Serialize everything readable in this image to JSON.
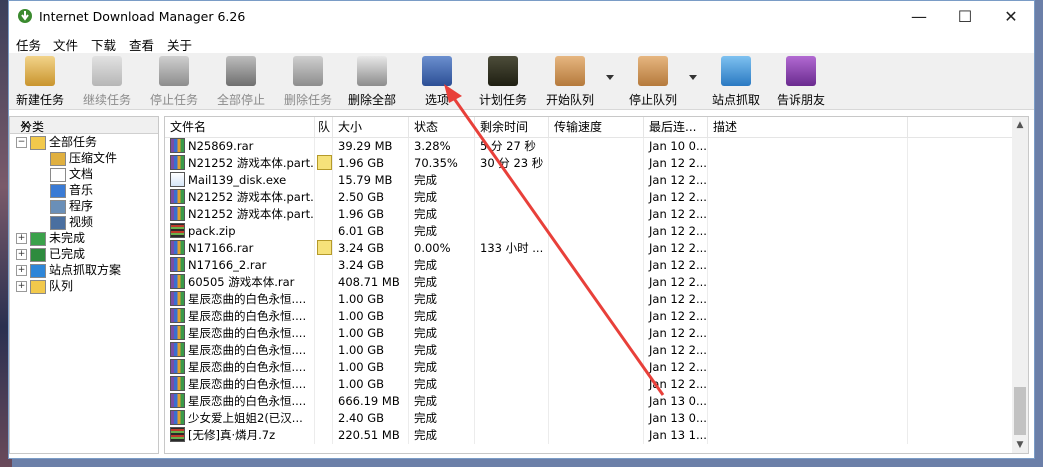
{
  "window": {
    "title": "Internet Download Manager 6.26"
  },
  "menu": [
    "任务",
    "文件",
    "下载",
    "查看",
    "关于"
  ],
  "toolbar": [
    {
      "label": "新建任务",
      "icon": "new-task-icon",
      "disabled": false
    },
    {
      "label": "继续任务",
      "icon": "resume-icon",
      "disabled": true
    },
    {
      "label": "停止任务",
      "icon": "stop-icon",
      "disabled": true
    },
    {
      "label": "全部停止",
      "icon": "stop-all-icon",
      "disabled": true
    },
    {
      "label": "删除任务",
      "icon": "delete-icon",
      "disabled": true
    },
    {
      "label": "删除全部",
      "icon": "delete-all-icon",
      "disabled": false
    },
    {
      "label": "选项",
      "icon": "options-icon",
      "disabled": false
    },
    {
      "label": "计划任务",
      "icon": "scheduler-icon",
      "disabled": false
    },
    {
      "label": "开始队列",
      "icon": "start-queue-icon",
      "disabled": false
    },
    {
      "label": "停止队列",
      "icon": "stop-queue-icon",
      "disabled": false
    },
    {
      "label": "站点抓取",
      "icon": "site-grabber-icon",
      "disabled": false
    },
    {
      "label": "告诉朋友",
      "icon": "tell-friend-icon",
      "disabled": false
    }
  ],
  "categories": {
    "header": "分类",
    "close": "×",
    "items": [
      {
        "label": "全部任务",
        "icon": "folder-open-icon",
        "level": 0,
        "expander": "−"
      },
      {
        "label": "压缩文件",
        "icon": "archive-icon",
        "level": 1,
        "expander": ""
      },
      {
        "label": "文档",
        "icon": "document-icon",
        "level": 1,
        "expander": ""
      },
      {
        "label": "音乐",
        "icon": "music-icon",
        "level": 1,
        "expander": ""
      },
      {
        "label": "程序",
        "icon": "program-icon",
        "level": 1,
        "expander": ""
      },
      {
        "label": "视频",
        "icon": "video-icon",
        "level": 1,
        "expander": ""
      },
      {
        "label": "未完成",
        "icon": "unfinished-icon",
        "level": 0,
        "expander": "+"
      },
      {
        "label": "已完成",
        "icon": "finished-icon",
        "level": 0,
        "expander": "+"
      },
      {
        "label": "站点抓取方案",
        "icon": "grabber-project-icon",
        "level": 0,
        "expander": "+"
      },
      {
        "label": "队列",
        "icon": "queue-folder-icon",
        "level": 0,
        "expander": "+"
      }
    ]
  },
  "columns": [
    "文件名",
    "队",
    "大小",
    "状态",
    "剩余时间",
    "传输速度",
    "最后连...",
    "描述"
  ],
  "files": [
    {
      "name": "N25869.rar",
      "q": "",
      "size": "39.29 MB",
      "status": "3.28%",
      "remaining": "5 分 27 秒",
      "speed": "",
      "last": "Jan 10 0...",
      "desc": "",
      "icon": "rar"
    },
    {
      "name": "N21252 游戏本体.part...",
      "q": "queue",
      "size": "1.96 GB",
      "status": "70.35%",
      "remaining": "30 分 23 秒",
      "speed": "",
      "last": "Jan 12 2...",
      "desc": "",
      "icon": "rar"
    },
    {
      "name": "Mail139_disk.exe",
      "q": "",
      "size": "15.79 MB",
      "status": "完成",
      "remaining": "",
      "speed": "",
      "last": "Jan 12 2...",
      "desc": "",
      "icon": "exe"
    },
    {
      "name": "N21252 游戏本体.part...",
      "q": "",
      "size": "2.50 GB",
      "status": "完成",
      "remaining": "",
      "speed": "",
      "last": "Jan 12 2...",
      "desc": "",
      "icon": "rar"
    },
    {
      "name": "N21252 游戏本体.part...",
      "q": "",
      "size": "1.96 GB",
      "status": "完成",
      "remaining": "",
      "speed": "",
      "last": "Jan 12 2...",
      "desc": "",
      "icon": "rar"
    },
    {
      "name": "pack.zip",
      "q": "",
      "size": "6.01 GB",
      "status": "完成",
      "remaining": "",
      "speed": "",
      "last": "Jan 12 2...",
      "desc": "",
      "icon": "zip"
    },
    {
      "name": "N17166.rar",
      "q": "queue",
      "size": "3.24 GB",
      "status": "0.00%",
      "remaining": "133 小时 ...",
      "speed": "",
      "last": "Jan 12 2...",
      "desc": "",
      "icon": "rar"
    },
    {
      "name": "N17166_2.rar",
      "q": "",
      "size": "3.24 GB",
      "status": "完成",
      "remaining": "",
      "speed": "",
      "last": "Jan 12 2...",
      "desc": "",
      "icon": "rar"
    },
    {
      "name": "60505 游戏本体.rar",
      "q": "",
      "size": "408.71 MB",
      "status": "完成",
      "remaining": "",
      "speed": "",
      "last": "Jan 12 2...",
      "desc": "",
      "icon": "rar"
    },
    {
      "name": "星辰恋曲的白色永恒....",
      "q": "",
      "size": "1.00 GB",
      "status": "完成",
      "remaining": "",
      "speed": "",
      "last": "Jan 12 2...",
      "desc": "",
      "icon": "rar"
    },
    {
      "name": "星辰恋曲的白色永恒....",
      "q": "",
      "size": "1.00 GB",
      "status": "完成",
      "remaining": "",
      "speed": "",
      "last": "Jan 12 2...",
      "desc": "",
      "icon": "rar"
    },
    {
      "name": "星辰恋曲的白色永恒....",
      "q": "",
      "size": "1.00 GB",
      "status": "完成",
      "remaining": "",
      "speed": "",
      "last": "Jan 12 2...",
      "desc": "",
      "icon": "rar"
    },
    {
      "name": "星辰恋曲的白色永恒....",
      "q": "",
      "size": "1.00 GB",
      "status": "完成",
      "remaining": "",
      "speed": "",
      "last": "Jan 12 2...",
      "desc": "",
      "icon": "rar"
    },
    {
      "name": "星辰恋曲的白色永恒....",
      "q": "",
      "size": "1.00 GB",
      "status": "完成",
      "remaining": "",
      "speed": "",
      "last": "Jan 12 2...",
      "desc": "",
      "icon": "rar"
    },
    {
      "name": "星辰恋曲的白色永恒....",
      "q": "",
      "size": "1.00 GB",
      "status": "完成",
      "remaining": "",
      "speed": "",
      "last": "Jan 12 2...",
      "desc": "",
      "icon": "rar"
    },
    {
      "name": "星辰恋曲的白色永恒....",
      "q": "",
      "size": "666.19 MB",
      "status": "完成",
      "remaining": "",
      "speed": "",
      "last": "Jan 13 0...",
      "desc": "",
      "icon": "rar"
    },
    {
      "name": "少女爱上姐姐2(已汉...",
      "q": "",
      "size": "2.40 GB",
      "status": "完成",
      "remaining": "",
      "speed": "",
      "last": "Jan 13 0...",
      "desc": "",
      "icon": "rar"
    },
    {
      "name": "[无修]真·燐月.7z",
      "q": "",
      "size": "220.51 MB",
      "status": "完成",
      "remaining": "",
      "speed": "",
      "last": "Jan 13 1...",
      "desc": "",
      "icon": "zip"
    }
  ],
  "colors": {
    "annotation_arrow": "#e8403a",
    "selection": "#cce8ff",
    "window_border": "#7a9cc6"
  }
}
